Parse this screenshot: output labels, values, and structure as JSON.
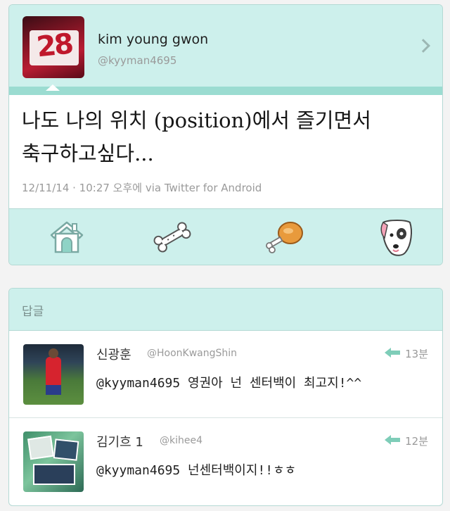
{
  "tweet": {
    "author_name": "kim young gwon",
    "author_handle": "@kyyman4695",
    "text_line1": "나도 나의 위치 (position)에서 즐기면서",
    "text_line2": "축구하고싶다...",
    "meta": "12/11/14 · 10:27 오후에 via Twitter for Android",
    "avatar_text": "28",
    "actions": [
      {
        "icon": "home-doghouse-icon"
      },
      {
        "icon": "bone-icon"
      },
      {
        "icon": "drumstick-icon"
      },
      {
        "icon": "dog-icon"
      }
    ]
  },
  "replies": {
    "title": "답글",
    "items": [
      {
        "name": "신광훈",
        "handle": "@HoonKwangShin",
        "time": "13분",
        "text": "@kyyman4695 영권아 넌 센터백이 최고지!^^"
      },
      {
        "name": "김기흐 1",
        "handle": "@kihee4",
        "time": "12분",
        "text": "@kyyman4695 넌센터백이지!!ㅎㅎ"
      }
    ]
  },
  "colors": {
    "mint_background": "#cdf0ec",
    "mint_band": "#9bdcd1",
    "reply_arrow": "#7ecdb8"
  }
}
